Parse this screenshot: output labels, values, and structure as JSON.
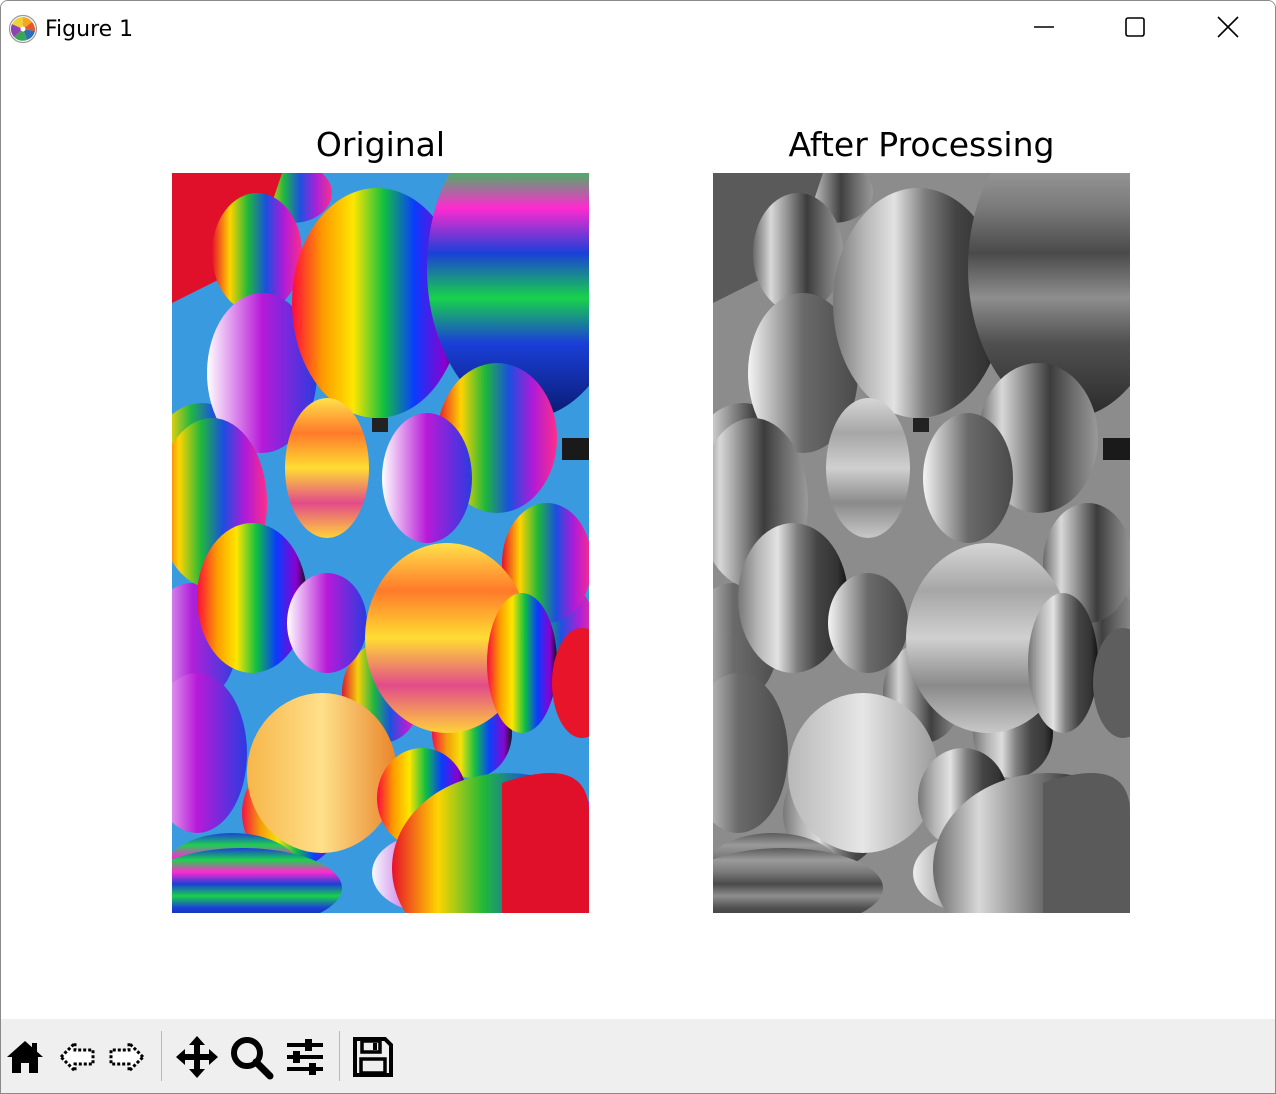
{
  "window": {
    "title": "Figure 1",
    "app_icon": "matplotlib-logo-icon",
    "controls": [
      "minimize-icon",
      "maximize-icon",
      "close-icon"
    ]
  },
  "figure": {
    "subplots": [
      {
        "title": "Original",
        "image": "colorful hot air balloons photo"
      },
      {
        "title": "After Processing",
        "image": "grayscale hot air balloons photo"
      }
    ]
  },
  "toolbar": {
    "tools": [
      "home-icon",
      "back-icon",
      "forward-icon",
      "pan-icon",
      "zoom-icon",
      "configure-subplots-icon",
      "save-icon"
    ]
  }
}
